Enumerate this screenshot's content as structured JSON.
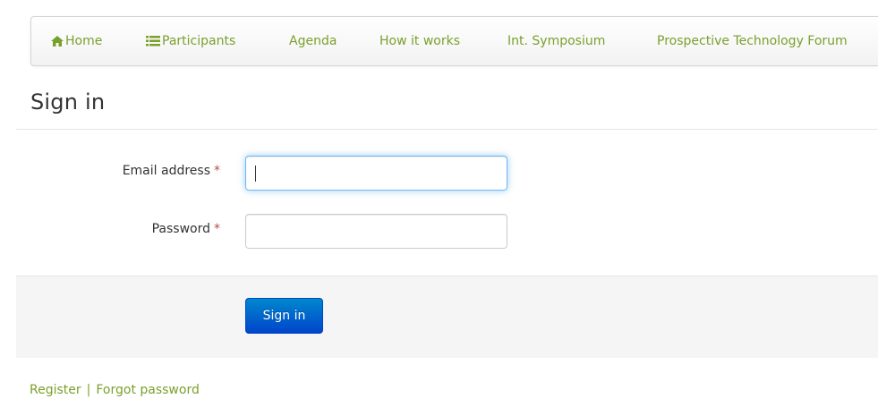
{
  "nav": {
    "items": [
      {
        "label": "Home",
        "icon": "home-icon"
      },
      {
        "label": "Participants",
        "icon": "list-icon"
      },
      {
        "label": "Agenda"
      },
      {
        "label": "How it works"
      },
      {
        "label": "Int. Symposium"
      },
      {
        "label": "Prospective Technology Forum"
      }
    ]
  },
  "page": {
    "title": "Sign in"
  },
  "form": {
    "email_label": "Email address",
    "email_value": "",
    "password_label": "Password",
    "password_value": "",
    "required_mark": "*",
    "submit_label": "Sign in"
  },
  "footer": {
    "register": "Register",
    "separator": "|",
    "forgot": "Forgot password"
  },
  "colors": {
    "link": "#7aa02c",
    "primary": "#0055cc",
    "required": "#b94a48"
  }
}
